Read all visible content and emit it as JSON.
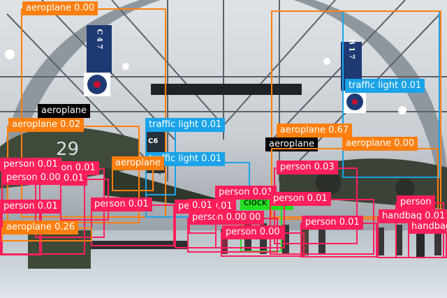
{
  "colors": {
    "aeroplane": "#ff7f0e",
    "person": "#ff1f5b",
    "traffic light": "#1aa3e8",
    "clock": "#22dd22",
    "handbag": "#ff1f5b",
    "highlight": "#000000"
  },
  "photo_signs": {
    "left_banner": "C 4 7",
    "right_banner": "B 1 7",
    "tail_number": "C6",
    "fuselage_number": "29"
  },
  "detections": [
    {
      "label": "aeroplane 0.00",
      "cls": "aeroplane"
    },
    {
      "label": "traffic light 0.01",
      "cls": "traffic light"
    },
    {
      "label": "aeroplane",
      "cls": "highlight"
    },
    {
      "label": "aeroplane 0.02",
      "cls": "aeroplane"
    },
    {
      "label": "traffic light 0.01",
      "cls": "traffic light"
    },
    {
      "label": "aeroplane 0.67",
      "cls": "aeroplane"
    },
    {
      "label": "aeroplane",
      "cls": "highlight"
    },
    {
      "label": "aeroplane 0.00",
      "cls": "aeroplane"
    },
    {
      "label": "traffic light 0.01",
      "cls": "traffic light"
    },
    {
      "label": "person 0.01",
      "cls": "person"
    },
    {
      "label": "person 0.01",
      "cls": "person"
    },
    {
      "label": "person 0.00",
      "cls": "person"
    },
    {
      "label": "aeroplane",
      "cls": "aeroplane"
    },
    {
      "label": "person 0.03",
      "cls": "person"
    },
    {
      "label": "person 0.01",
      "cls": "person"
    },
    {
      "label": "clock 0.00",
      "cls": "clock"
    },
    {
      "label": "person 0.01",
      "cls": "person"
    },
    {
      "label": "person 0.01",
      "cls": "person"
    },
    {
      "label": "person 0.01",
      "cls": "person"
    },
    {
      "label": "person 0.00 00",
      "cls": "person"
    },
    {
      "label": "person 0.01",
      "cls": "person"
    },
    {
      "label": "person 0.01",
      "cls": "person"
    },
    {
      "label": "person 0.00",
      "cls": "person"
    },
    {
      "label": "person",
      "cls": "person"
    },
    {
      "label": "handbag 0.01",
      "cls": "handbag"
    },
    {
      "label": "handbag",
      "cls": "handbag"
    },
    {
      "label": "aeroplane 0.26",
      "cls": "aeroplane"
    },
    {
      "label": "0.01",
      "cls": "person"
    },
    {
      "label": "0.01",
      "cls": "person"
    }
  ]
}
